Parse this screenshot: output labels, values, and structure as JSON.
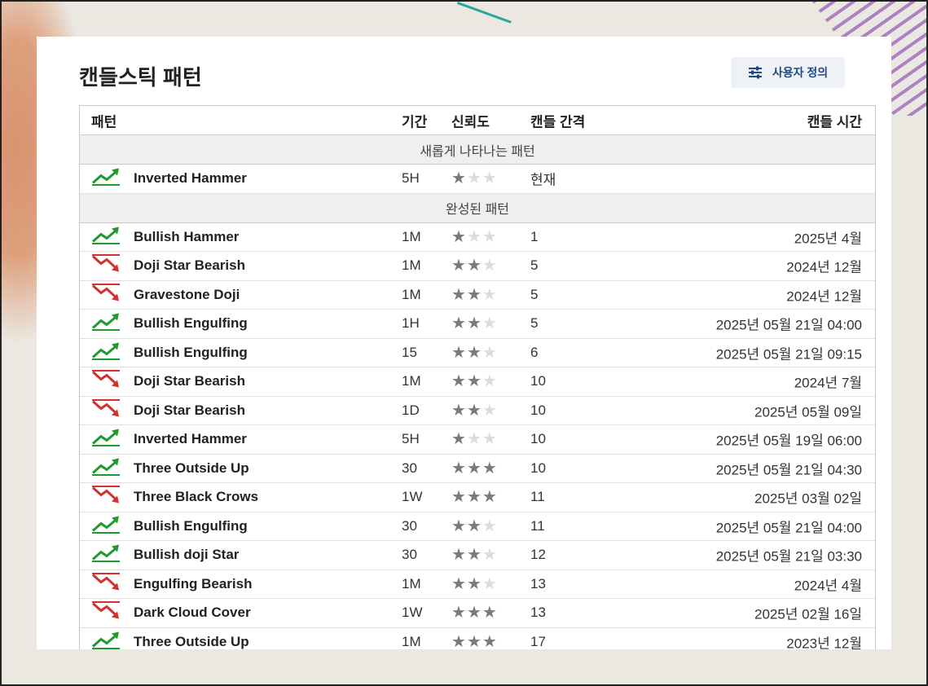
{
  "title": "캔들스틱 패턴",
  "custom_button": {
    "label": "사용자 정의",
    "icon": "sliders-icon"
  },
  "headers": {
    "pattern": "패턴",
    "period": "기간",
    "reliability": "신뢰도",
    "candle_gap": "캔들 간격",
    "candle_time": "캔들 시간"
  },
  "sections": [
    {
      "label": "새롭게 나타나는 패턴",
      "rows": [
        {
          "direction": "up",
          "name": "Inverted Hammer",
          "period": "5H",
          "stars": 1,
          "gap": "현재",
          "time": ""
        }
      ]
    },
    {
      "label": "완성된 패턴",
      "rows": [
        {
          "direction": "up",
          "name": "Bullish Hammer",
          "period": "1M",
          "stars": 1,
          "gap": "1",
          "time": "2025년 4월"
        },
        {
          "direction": "down",
          "name": "Doji Star Bearish",
          "period": "1M",
          "stars": 2,
          "gap": "5",
          "time": "2024년 12월"
        },
        {
          "direction": "down",
          "name": "Gravestone Doji",
          "period": "1M",
          "stars": 2,
          "gap": "5",
          "time": "2024년 12월"
        },
        {
          "direction": "up",
          "name": "Bullish Engulfing",
          "period": "1H",
          "stars": 2,
          "gap": "5",
          "time": "2025년 05월 21일 04:00"
        },
        {
          "direction": "up",
          "name": "Bullish Engulfing",
          "period": "15",
          "stars": 2,
          "gap": "6",
          "time": "2025년 05월 21일 09:15"
        },
        {
          "direction": "down",
          "name": "Doji Star Bearish",
          "period": "1M",
          "stars": 2,
          "gap": "10",
          "time": "2024년 7월"
        },
        {
          "direction": "down",
          "name": "Doji Star Bearish",
          "period": "1D",
          "stars": 2,
          "gap": "10",
          "time": "2025년 05월 09일"
        },
        {
          "direction": "up",
          "name": "Inverted Hammer",
          "period": "5H",
          "stars": 1,
          "gap": "10",
          "time": "2025년 05월 19일 06:00"
        },
        {
          "direction": "up",
          "name": "Three Outside Up",
          "period": "30",
          "stars": 3,
          "gap": "10",
          "time": "2025년 05월 21일 04:30"
        },
        {
          "direction": "down",
          "name": "Three Black Crows",
          "period": "1W",
          "stars": 3,
          "gap": "11",
          "time": "2025년 03월 02일"
        },
        {
          "direction": "up",
          "name": "Bullish Engulfing",
          "period": "30",
          "stars": 2,
          "gap": "11",
          "time": "2025년 05월 21일 04:00"
        },
        {
          "direction": "up",
          "name": "Bullish doji Star",
          "period": "30",
          "stars": 2,
          "gap": "12",
          "time": "2025년 05월 21일 03:30"
        },
        {
          "direction": "down",
          "name": "Engulfing Bearish",
          "period": "1M",
          "stars": 2,
          "gap": "13",
          "time": "2024년 4월"
        },
        {
          "direction": "down",
          "name": "Dark Cloud Cover",
          "period": "1W",
          "stars": 3,
          "gap": "13",
          "time": "2025년 02월 16일"
        },
        {
          "direction": "up",
          "name": "Three Outside Up",
          "period": "1M",
          "stars": 3,
          "gap": "17",
          "time": "2023년 12월"
        }
      ]
    }
  ],
  "colors": {
    "up": "#1e9a2e",
    "down": "#d0312d",
    "star_on": "#7a7a7a",
    "star_off": "#dcdcdc",
    "accent": "#1c4a80"
  }
}
